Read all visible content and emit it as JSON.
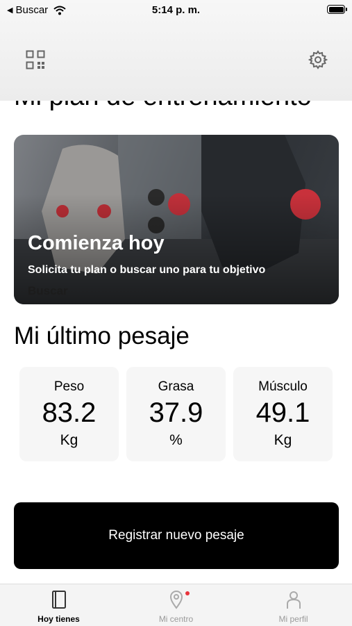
{
  "status_bar": {
    "back_label": "Buscar",
    "time": "5:14 p. m."
  },
  "header": {
    "left_icon": "qr-code-icon",
    "right_icon": "gear-icon",
    "partial_title": "Mi plan de entrenamiento"
  },
  "promo_card": {
    "title": "Comienza hoy",
    "subtitle": "Solicita tu plan o buscar uno para tu objetivo",
    "link_label": "Buscar"
  },
  "weigh_in": {
    "title": "Mi último pesaje",
    "stats": [
      {
        "label": "Peso",
        "value": "83.2",
        "unit": "Kg"
      },
      {
        "label": "Grasa",
        "value": "37.9",
        "unit": "%"
      },
      {
        "label": "Músculo",
        "value": "49.1",
        "unit": "Kg"
      }
    ]
  },
  "actions": {
    "register_label": "Registrar nuevo pesaje"
  },
  "tabbar": {
    "tabs": [
      {
        "label": "Hoy tienes",
        "icon": "notebook-icon",
        "active": true
      },
      {
        "label": "Mi centro",
        "icon": "location-pin-icon",
        "active": false,
        "badge": true
      },
      {
        "label": "Mi perfil",
        "icon": "person-icon",
        "active": false
      }
    ]
  },
  "colors": {
    "accent": "#000000",
    "badge": "#e8343c",
    "inactive_tab": "#9a9a9a"
  }
}
